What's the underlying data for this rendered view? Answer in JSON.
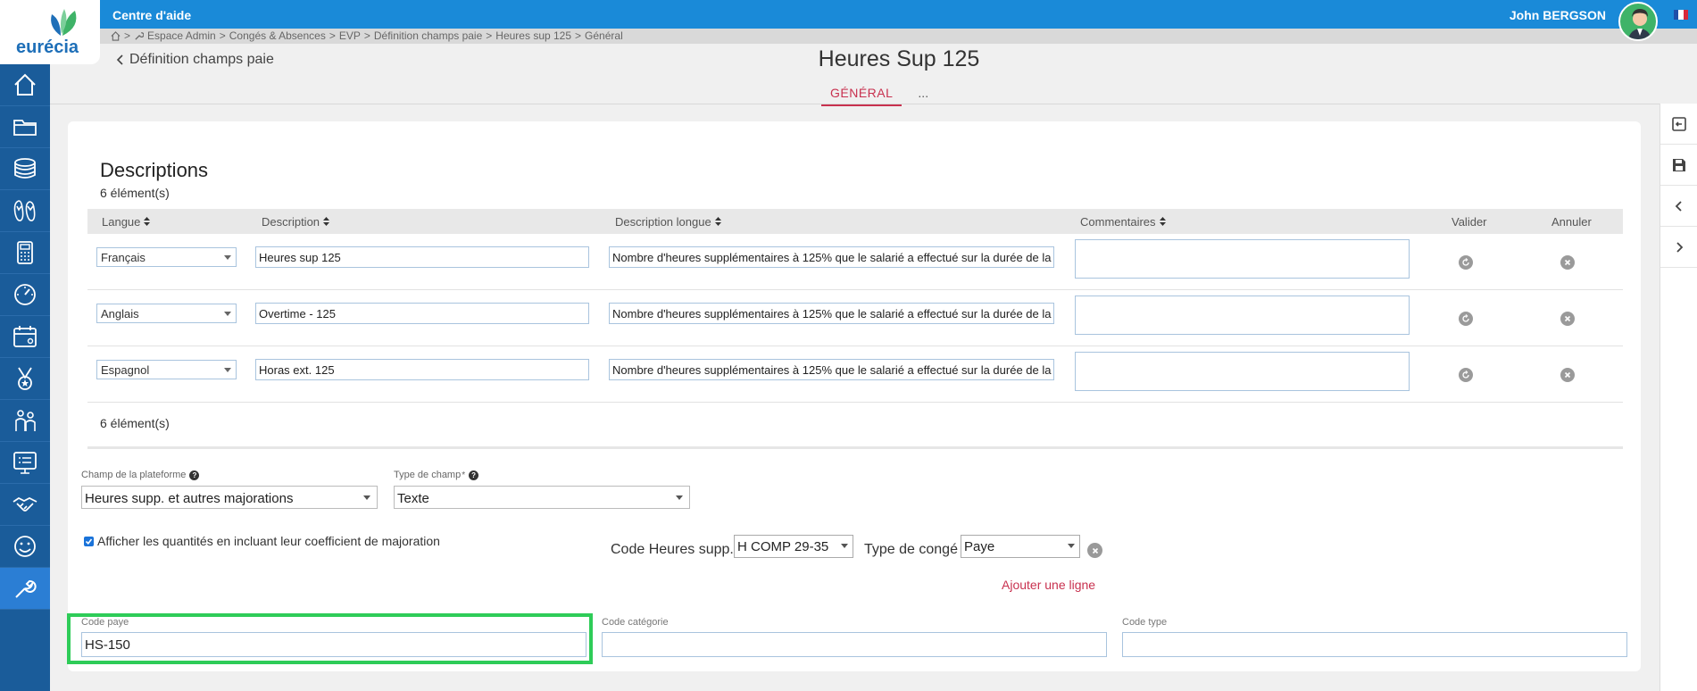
{
  "topbar": {
    "help_link": "Centre d'aide",
    "user_name": "John  BERGSON",
    "logo_text": "eurécia",
    "colors": {
      "bar": "#1a8ad8",
      "sidebar": "#1a5c9a",
      "accent": "#c8314f",
      "highlight": "#2ecc58"
    }
  },
  "breadcrumb": {
    "separator": ">",
    "items": [
      "Espace Admin",
      "Congés & Absences",
      "EVP",
      "Définition champs paie",
      "Heures sup 125",
      "Général"
    ]
  },
  "sidebar": {
    "items": [
      "home-icon",
      "folder-icon",
      "coins-icon",
      "flip-flops-icon",
      "calculator-icon",
      "gauge-icon",
      "calendar-icon",
      "medal-icon",
      "people-icon",
      "presentation-icon",
      "handshake-icon",
      "smiley-icon",
      "wrench-icon"
    ],
    "active": "wrench-icon"
  },
  "rightbar": {
    "items": [
      "save-back-icon",
      "save-icon",
      "chevron-left-icon",
      "chevron-right-icon"
    ]
  },
  "header": {
    "back_label": "Définition champs paie",
    "title": "Heures Sup 125",
    "tabs": [
      "GÉNÉRAL",
      "..."
    ],
    "active_tab": "GÉNÉRAL"
  },
  "descriptions": {
    "title": "Descriptions",
    "count_label": "6 élément(s)",
    "columns": [
      "Langue",
      "Description",
      "Description longue",
      "Commentaires",
      "Valider",
      "Annuler"
    ],
    "rows": [
      {
        "langue": "Français",
        "description": "Heures sup 125",
        "description_longue": "Nombre d'heures supplémentaires à 125% que le salarié a effectué sur la durée de la",
        "commentaire": ""
      },
      {
        "langue": "Anglais",
        "description": "Overtime - 125",
        "description_longue": "Nombre d'heures supplémentaires à 125% que le salarié a effectué sur la durée de la",
        "commentaire": ""
      },
      {
        "langue": "Espagnol",
        "description": "Horas ext. 125",
        "description_longue": "Nombre d'heures supplémentaires à 125% que le salarié a effectué sur la durée de la",
        "commentaire": ""
      }
    ]
  },
  "settings": {
    "platform_field_label": "Champ de la plateforme",
    "platform_field_value": "Heures supp. et autres majorations",
    "field_type_label": "Type de champ",
    "required_mark": "*",
    "field_type_value": "Texte",
    "checkbox_label": "Afficher les quantités en incluant leur coefficient de majoration",
    "checkbox_checked": true,
    "code_hs_label": "Code Heures supp.",
    "code_hs_value": "H COMP 29-35",
    "leave_type_label": "Type de congé",
    "leave_type_value": "Paye",
    "add_line": "Ajouter une ligne"
  },
  "codes": {
    "pay_code_label": "Code paye",
    "pay_code_value": "HS-150",
    "category_label": "Code catégorie",
    "category_value": "",
    "type_label": "Code type",
    "type_value": ""
  }
}
